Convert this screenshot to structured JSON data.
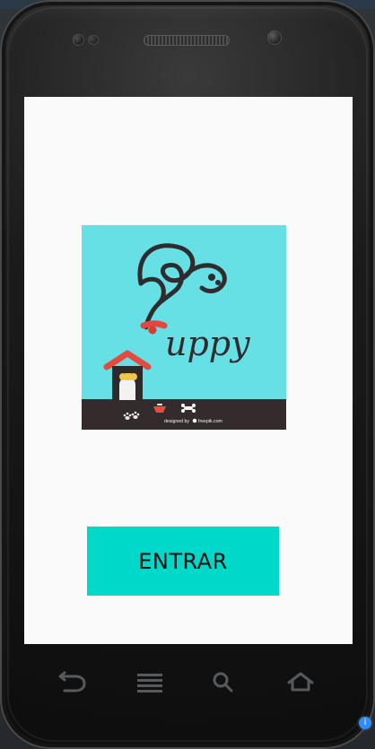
{
  "app": {
    "button_label": "ENTRAR",
    "logo_text": "uppy",
    "credit_text": "designed by",
    "credit_brand": "freepik.com"
  },
  "phone": {
    "info_badge": "i"
  },
  "icons": {
    "back": "back-icon",
    "menu": "menu-icon",
    "search": "search-icon",
    "home": "home-icon"
  },
  "colors": {
    "screen_bg": "#fafafa",
    "logo_bg": "#66dfe5",
    "button_bg": "#00d8c9",
    "ground": "#342b2c"
  }
}
